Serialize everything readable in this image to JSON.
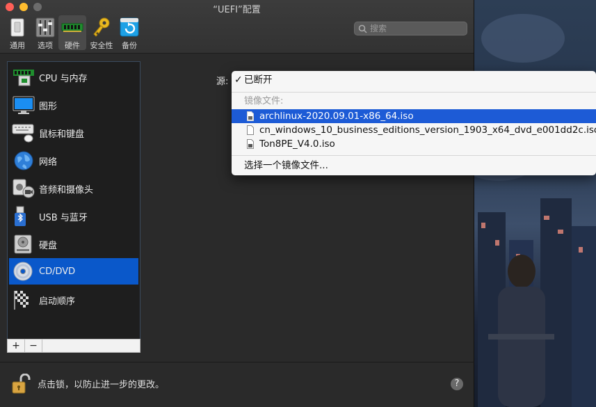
{
  "window": {
    "title": "“UEFI”配置"
  },
  "toolbar": {
    "items": [
      {
        "label": "通用",
        "icon": "switch-icon"
      },
      {
        "label": "选项",
        "icon": "sliders-icon"
      },
      {
        "label": "硬件",
        "icon": "memory-chip-icon"
      },
      {
        "label": "安全性",
        "icon": "key-icon"
      },
      {
        "label": "备份",
        "icon": "backup-icon"
      }
    ],
    "active_index": 2,
    "search_placeholder": "搜索"
  },
  "sidebar": {
    "items": [
      {
        "label": "CPU 与内存",
        "icon": "cpu-memory-icon"
      },
      {
        "label": "图形",
        "icon": "monitor-icon"
      },
      {
        "label": "鼠标和键盘",
        "icon": "keyboard-mouse-icon"
      },
      {
        "label": "网络",
        "icon": "globe-icon"
      },
      {
        "label": "音频和摄像头",
        "icon": "speaker-camera-icon"
      },
      {
        "label": "USB 与蓝牙",
        "icon": "usb-bluetooth-icon"
      },
      {
        "label": "硬盘",
        "icon": "hard-disk-icon"
      },
      {
        "label": "CD/DVD",
        "icon": "cd-icon"
      },
      {
        "label": "启动顺序",
        "icon": "boot-order-icon"
      }
    ],
    "selected_index": 7,
    "add_label": "+",
    "remove_label": "−"
  },
  "content": {
    "source_label": "源:",
    "source_options": {
      "selected": "已断开",
      "section_header": "镜像文件:",
      "files": [
        "archlinux-2020.09.01-x86_64.iso",
        "cn_windows_10_business_editions_version_1903_x64_dvd_e001dd2c.iso",
        "Ton8PE_V4.0.iso"
      ],
      "highlighted_index": 0,
      "choose_image": "选择一个镜像文件..."
    }
  },
  "footer": {
    "lock_text": "点击锁，以防止进一步的更改。",
    "help_label": "?"
  },
  "colors": {
    "selection": "#0a58ca",
    "menu_highlight": "#1d5bd6"
  }
}
